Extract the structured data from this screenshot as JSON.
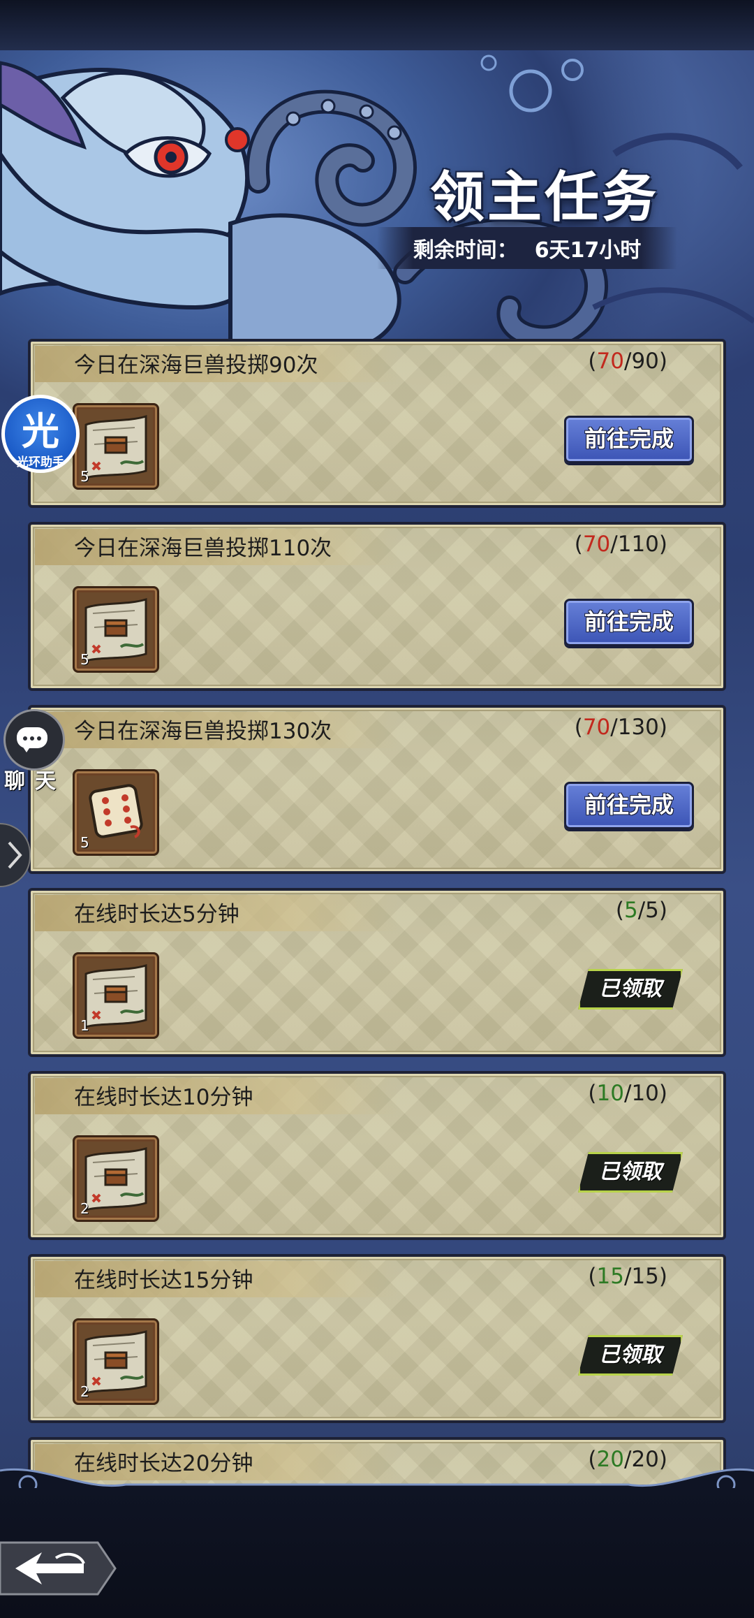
{
  "header": {
    "title": "领主任务",
    "timer_label": "剩余时间：",
    "timer_value": "6天17小时"
  },
  "assistant": {
    "char": "光",
    "label": "光环助手"
  },
  "chat": {
    "label": "聊天"
  },
  "tasks": [
    {
      "title": "今日在深海巨兽投掷90次",
      "progress_open": "(",
      "current": "70",
      "sep": "/",
      "target": "90",
      "progress_close": ")",
      "current_color": "red",
      "reward_icon": "treasure-map-icon",
      "reward_count": "5",
      "action": "前往完成",
      "state": "go"
    },
    {
      "title": "今日在深海巨兽投掷110次",
      "progress_open": "(",
      "current": "70",
      "sep": "/",
      "target": "110",
      "progress_close": ")",
      "current_color": "red",
      "reward_icon": "treasure-map-icon",
      "reward_count": "5",
      "action": "前往完成",
      "state": "go"
    },
    {
      "title": "今日在深海巨兽投掷130次",
      "progress_open": "(",
      "current": "70",
      "sep": "/",
      "target": "130",
      "progress_close": ")",
      "current_color": "red",
      "reward_icon": "dice-icon",
      "reward_count": "5",
      "action": "前往完成",
      "state": "go"
    },
    {
      "title": "在线时长达5分钟",
      "progress_open": "(",
      "current": "5",
      "sep": "/",
      "target": "5",
      "progress_close": ")",
      "current_color": "green",
      "reward_icon": "treasure-map-icon",
      "reward_count": "1",
      "action": "已领取",
      "state": "claimed"
    },
    {
      "title": "在线时长达10分钟",
      "progress_open": "(",
      "current": "10",
      "sep": "/",
      "target": "10",
      "progress_close": ")",
      "current_color": "green",
      "reward_icon": "treasure-map-icon",
      "reward_count": "2",
      "action": "已领取",
      "state": "claimed"
    },
    {
      "title": "在线时长达15分钟",
      "progress_open": "(",
      "current": "15",
      "sep": "/",
      "target": "15",
      "progress_close": ")",
      "current_color": "green",
      "reward_icon": "treasure-map-icon",
      "reward_count": "2",
      "action": "已领取",
      "state": "claimed"
    },
    {
      "title": "在线时长达20分钟",
      "progress_open": "(",
      "current": "20",
      "sep": "/",
      "target": "20",
      "progress_close": ")",
      "current_color": "green",
      "reward_icon": "treasure-map-icon",
      "reward_count": "",
      "action": "",
      "state": "partial"
    }
  ],
  "colors": {
    "progress_red": "#c2291e",
    "progress_green": "#2d7a24",
    "button_blue": "#3c54b5",
    "claimed_lime": "#b8d34a"
  }
}
